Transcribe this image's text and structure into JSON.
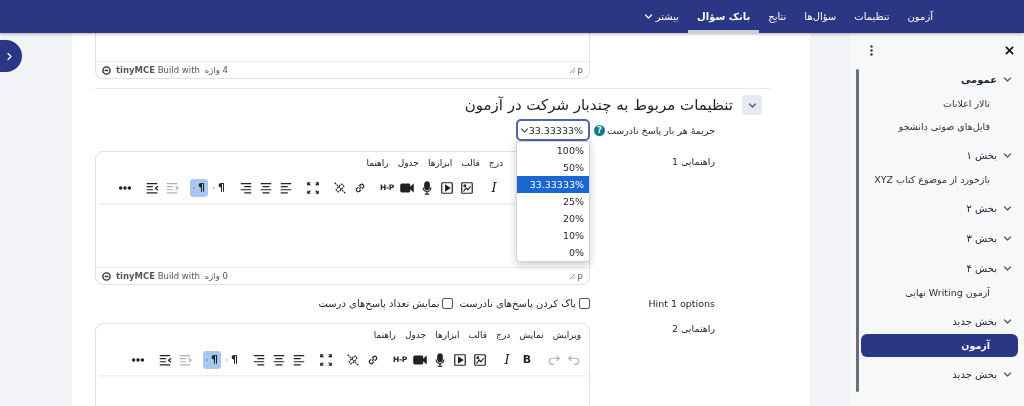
{
  "nav": {
    "tabs": [
      {
        "label": "آزمون",
        "selected": false,
        "kind": "link"
      },
      {
        "label": "تنظیمات",
        "selected": false,
        "kind": "link"
      },
      {
        "label": "سؤال‌ها",
        "selected": false,
        "kind": "link"
      },
      {
        "label": "نتایج",
        "selected": false,
        "kind": "link"
      },
      {
        "label": "بانک سؤال",
        "selected": true,
        "kind": "link"
      },
      {
        "label": "بیشتر",
        "selected": false,
        "kind": "menu"
      }
    ]
  },
  "top_editor": {
    "path": "p",
    "word_count": "4 واژه",
    "branding": "**tinyMCE** Build with"
  },
  "section": {
    "title": "تنظیمات مربوط به چندبار شرکت در آزمون",
    "expanded": true
  },
  "penalty": {
    "label": "جریمهٔ هر بار پاسخ نادرست",
    "help": "?",
    "value": "33.33333%",
    "expanded": true,
    "options": [
      {
        "label": "100%",
        "selected": false
      },
      {
        "label": "50%",
        "selected": false
      },
      {
        "label": "33.33333%",
        "selected": true
      },
      {
        "label": "25%",
        "selected": false
      },
      {
        "label": "20%",
        "selected": false
      },
      {
        "label": "10%",
        "selected": false
      },
      {
        "label": "0%",
        "selected": false
      }
    ]
  },
  "hint_1": {
    "label": "راهنمایی 1",
    "editor": {
      "menu": [
        "درج",
        "قالب",
        "ابزارها",
        "جدول",
        "راهنما"
      ],
      "toolbar": [
        [
          {
            "kind": "italic",
            "label": "I",
            "on": false,
            "disabled": false
          }
        ],
        [
          {
            "kind": "image",
            "on": false,
            "disabled": false
          },
          {
            "kind": "media",
            "on": false,
            "disabled": false
          },
          {
            "kind": "mic",
            "on": false,
            "disabled": false
          },
          {
            "kind": "video",
            "on": false,
            "disabled": false
          },
          {
            "kind": "h5p",
            "label": "H-P",
            "on": false,
            "disabled": false
          }
        ],
        [
          {
            "kind": "link",
            "on": false,
            "disabled": false
          },
          {
            "kind": "unlink",
            "on": false,
            "disabled": false
          }
        ],
        [
          {
            "kind": "fullscreen",
            "on": false,
            "disabled": false
          }
        ],
        [
          {
            "kind": "align-left",
            "on": false,
            "disabled": false
          },
          {
            "kind": "align-center",
            "on": false,
            "disabled": false
          },
          {
            "kind": "align-right",
            "on": false,
            "disabled": false
          }
        ],
        [
          {
            "kind": "ltr",
            "label": "¶",
            "on": false,
            "disabled": false
          },
          {
            "kind": "rtl",
            "label": "¶",
            "on": true,
            "disabled": false
          }
        ],
        [
          {
            "kind": "outdent",
            "on": false,
            "disabled": true
          },
          {
            "kind": "indent",
            "on": false,
            "disabled": false
          }
        ],
        [
          {
            "kind": "more",
            "on": false,
            "disabled": false
          }
        ]
      ],
      "path": "p",
      "word_count": "0 واژه",
      "branding": "**tinyMCE** Build with"
    }
  },
  "hint_1_options": {
    "label": "Hint 1 options",
    "checkboxes": [
      {
        "label": "پاک کردن پاسخ‌های نادرست",
        "checked": false
      },
      {
        "label": "نمایش تعداد پاسخ‌های درست",
        "checked": false
      }
    ]
  },
  "hint_2": {
    "label": "راهنمایی 2",
    "editor": {
      "menu": [
        "ویرایش",
        "نمایش",
        "درج",
        "قالب",
        "ابزارها",
        "جدول",
        "راهنما"
      ],
      "toolbar": [
        [
          {
            "kind": "undo",
            "on": false,
            "disabled": true
          },
          {
            "kind": "redo",
            "on": false,
            "disabled": true
          }
        ],
        [
          {
            "kind": "bold",
            "label": "B",
            "on": false,
            "disabled": false
          },
          {
            "kind": "italic",
            "label": "I",
            "on": false,
            "disabled": false
          }
        ],
        [
          {
            "kind": "image",
            "on": false,
            "disabled": false
          },
          {
            "kind": "media",
            "on": false,
            "disabled": false
          },
          {
            "kind": "mic",
            "on": false,
            "disabled": false
          },
          {
            "kind": "video",
            "on": false,
            "disabled": false
          },
          {
            "kind": "h5p",
            "label": "H-P",
            "on": false,
            "disabled": false
          }
        ],
        [
          {
            "kind": "link",
            "on": false,
            "disabled": false
          },
          {
            "kind": "unlink",
            "on": false,
            "disabled": false
          }
        ],
        [
          {
            "kind": "fullscreen",
            "on": false,
            "disabled": false
          }
        ],
        [
          {
            "kind": "align-left",
            "on": false,
            "disabled": false
          },
          {
            "kind": "align-center",
            "on": false,
            "disabled": false
          },
          {
            "kind": "align-right",
            "on": false,
            "disabled": false
          }
        ],
        [
          {
            "kind": "ltr",
            "label": "¶",
            "on": false,
            "disabled": false
          },
          {
            "kind": "rtl",
            "label": "¶",
            "on": true,
            "disabled": false
          }
        ],
        [
          {
            "kind": "outdent",
            "on": false,
            "disabled": true
          },
          {
            "kind": "indent",
            "on": false,
            "disabled": false
          }
        ],
        [
          {
            "kind": "more",
            "on": false,
            "disabled": false
          }
        ]
      ]
    }
  },
  "drawer": {
    "sections": [
      {
        "title": "عمومی",
        "expanded": true,
        "items": [
          {
            "label": "تالار اعلانات",
            "selected": false
          },
          {
            "label": "فایل‌های صوتی دانشجو",
            "selected": false
          }
        ]
      },
      {
        "title": "بخش ۱",
        "expanded": true,
        "items": [
          {
            "label": "بازخورد از موضوع کتاب XYZ",
            "selected": false
          }
        ]
      },
      {
        "title": "بخش ۲",
        "expanded": true
      },
      {
        "title": "بخش ۳",
        "expanded": true
      },
      {
        "title": "بخش ۴",
        "expanded": true,
        "items": [
          {
            "label": "آزمون Writing نهایی",
            "selected": false
          }
        ]
      },
      {
        "title": "بخش جدید",
        "expanded": true,
        "items": [
          {
            "label": "آزمون",
            "selected": true
          }
        ]
      },
      {
        "title": "بخش جدید",
        "expanded": true
      }
    ]
  }
}
